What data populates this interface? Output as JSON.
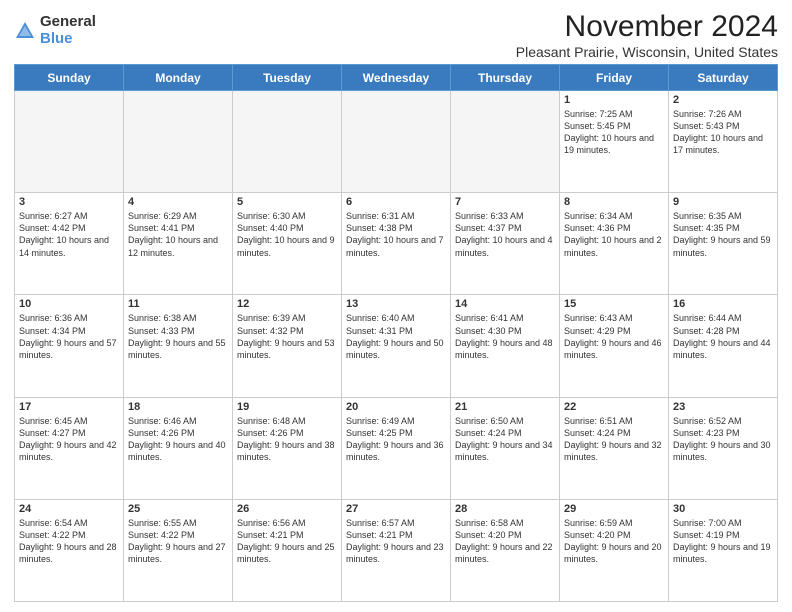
{
  "logo": {
    "general": "General",
    "blue": "Blue"
  },
  "title": "November 2024",
  "location": "Pleasant Prairie, Wisconsin, United States",
  "days_header": [
    "Sunday",
    "Monday",
    "Tuesday",
    "Wednesday",
    "Thursday",
    "Friday",
    "Saturday"
  ],
  "weeks": [
    [
      {
        "day": "",
        "info": "",
        "empty": true
      },
      {
        "day": "",
        "info": "",
        "empty": true
      },
      {
        "day": "",
        "info": "",
        "empty": true
      },
      {
        "day": "",
        "info": "",
        "empty": true
      },
      {
        "day": "",
        "info": "",
        "empty": true
      },
      {
        "day": "1",
        "info": "Sunrise: 7:25 AM\nSunset: 5:45 PM\nDaylight: 10 hours and 19 minutes."
      },
      {
        "day": "2",
        "info": "Sunrise: 7:26 AM\nSunset: 5:43 PM\nDaylight: 10 hours and 17 minutes."
      }
    ],
    [
      {
        "day": "3",
        "info": "Sunrise: 6:27 AM\nSunset: 4:42 PM\nDaylight: 10 hours and 14 minutes."
      },
      {
        "day": "4",
        "info": "Sunrise: 6:29 AM\nSunset: 4:41 PM\nDaylight: 10 hours and 12 minutes."
      },
      {
        "day": "5",
        "info": "Sunrise: 6:30 AM\nSunset: 4:40 PM\nDaylight: 10 hours and 9 minutes."
      },
      {
        "day": "6",
        "info": "Sunrise: 6:31 AM\nSunset: 4:38 PM\nDaylight: 10 hours and 7 minutes."
      },
      {
        "day": "7",
        "info": "Sunrise: 6:33 AM\nSunset: 4:37 PM\nDaylight: 10 hours and 4 minutes."
      },
      {
        "day": "8",
        "info": "Sunrise: 6:34 AM\nSunset: 4:36 PM\nDaylight: 10 hours and 2 minutes."
      },
      {
        "day": "9",
        "info": "Sunrise: 6:35 AM\nSunset: 4:35 PM\nDaylight: 9 hours and 59 minutes."
      }
    ],
    [
      {
        "day": "10",
        "info": "Sunrise: 6:36 AM\nSunset: 4:34 PM\nDaylight: 9 hours and 57 minutes."
      },
      {
        "day": "11",
        "info": "Sunrise: 6:38 AM\nSunset: 4:33 PM\nDaylight: 9 hours and 55 minutes."
      },
      {
        "day": "12",
        "info": "Sunrise: 6:39 AM\nSunset: 4:32 PM\nDaylight: 9 hours and 53 minutes."
      },
      {
        "day": "13",
        "info": "Sunrise: 6:40 AM\nSunset: 4:31 PM\nDaylight: 9 hours and 50 minutes."
      },
      {
        "day": "14",
        "info": "Sunrise: 6:41 AM\nSunset: 4:30 PM\nDaylight: 9 hours and 48 minutes."
      },
      {
        "day": "15",
        "info": "Sunrise: 6:43 AM\nSunset: 4:29 PM\nDaylight: 9 hours and 46 minutes."
      },
      {
        "day": "16",
        "info": "Sunrise: 6:44 AM\nSunset: 4:28 PM\nDaylight: 9 hours and 44 minutes."
      }
    ],
    [
      {
        "day": "17",
        "info": "Sunrise: 6:45 AM\nSunset: 4:27 PM\nDaylight: 9 hours and 42 minutes."
      },
      {
        "day": "18",
        "info": "Sunrise: 6:46 AM\nSunset: 4:26 PM\nDaylight: 9 hours and 40 minutes."
      },
      {
        "day": "19",
        "info": "Sunrise: 6:48 AM\nSunset: 4:26 PM\nDaylight: 9 hours and 38 minutes."
      },
      {
        "day": "20",
        "info": "Sunrise: 6:49 AM\nSunset: 4:25 PM\nDaylight: 9 hours and 36 minutes."
      },
      {
        "day": "21",
        "info": "Sunrise: 6:50 AM\nSunset: 4:24 PM\nDaylight: 9 hours and 34 minutes."
      },
      {
        "day": "22",
        "info": "Sunrise: 6:51 AM\nSunset: 4:24 PM\nDaylight: 9 hours and 32 minutes."
      },
      {
        "day": "23",
        "info": "Sunrise: 6:52 AM\nSunset: 4:23 PM\nDaylight: 9 hours and 30 minutes."
      }
    ],
    [
      {
        "day": "24",
        "info": "Sunrise: 6:54 AM\nSunset: 4:22 PM\nDaylight: 9 hours and 28 minutes."
      },
      {
        "day": "25",
        "info": "Sunrise: 6:55 AM\nSunset: 4:22 PM\nDaylight: 9 hours and 27 minutes."
      },
      {
        "day": "26",
        "info": "Sunrise: 6:56 AM\nSunset: 4:21 PM\nDaylight: 9 hours and 25 minutes."
      },
      {
        "day": "27",
        "info": "Sunrise: 6:57 AM\nSunset: 4:21 PM\nDaylight: 9 hours and 23 minutes."
      },
      {
        "day": "28",
        "info": "Sunrise: 6:58 AM\nSunset: 4:20 PM\nDaylight: 9 hours and 22 minutes."
      },
      {
        "day": "29",
        "info": "Sunrise: 6:59 AM\nSunset: 4:20 PM\nDaylight: 9 hours and 20 minutes."
      },
      {
        "day": "30",
        "info": "Sunrise: 7:00 AM\nSunset: 4:19 PM\nDaylight: 9 hours and 19 minutes."
      }
    ]
  ]
}
